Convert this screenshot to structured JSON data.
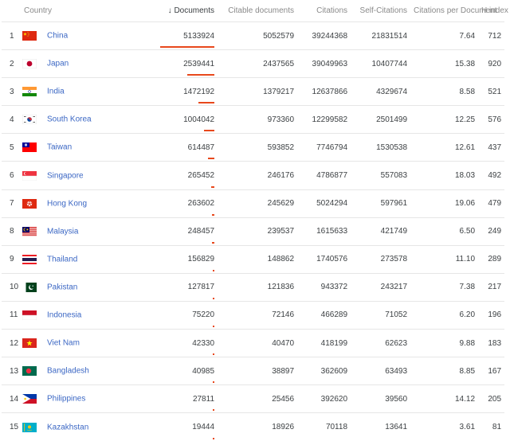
{
  "header": {
    "country": "Country",
    "sort_arrow": "↓",
    "documents": "Documents",
    "citable_documents": "Citable documents",
    "citations": "Citations",
    "self_citations": "Self-Citations",
    "citations_per_document": "Citations per Document",
    "h_index": "H index"
  },
  "colors": {
    "link": "#3b67c4",
    "bar": "#e8481c"
  },
  "rows": [
    {
      "rank": "1",
      "flag": "china-flag",
      "country": "China",
      "documents": "5133924",
      "citable": "5052579",
      "citations": "39244368",
      "self": "21831514",
      "cpd": "7.64",
      "h": "712",
      "bar": 1.0
    },
    {
      "rank": "2",
      "flag": "japan-flag",
      "country": "Japan",
      "documents": "2539441",
      "citable": "2437565",
      "citations": "39049963",
      "self": "10407744",
      "cpd": "15.38",
      "h": "920",
      "bar": 0.495
    },
    {
      "rank": "3",
      "flag": "india-flag",
      "country": "India",
      "documents": "1472192",
      "citable": "1379217",
      "citations": "12637866",
      "self": "4329674",
      "cpd": "8.58",
      "h": "521",
      "bar": 0.287
    },
    {
      "rank": "4",
      "flag": "south-korea-flag",
      "country": "South Korea",
      "documents": "1004042",
      "citable": "973360",
      "citations": "12299582",
      "self": "2501499",
      "cpd": "12.25",
      "h": "576",
      "bar": 0.196
    },
    {
      "rank": "5",
      "flag": "taiwan-flag",
      "country": "Taiwan",
      "documents": "614487",
      "citable": "593852",
      "citations": "7746794",
      "self": "1530538",
      "cpd": "12.61",
      "h": "437",
      "bar": 0.12
    },
    {
      "rank": "6",
      "flag": "singapore-flag",
      "country": "Singapore",
      "documents": "265452",
      "citable": "246176",
      "citations": "4786877",
      "self": "557083",
      "cpd": "18.03",
      "h": "492",
      "bar": 0.052
    },
    {
      "rank": "7",
      "flag": "hong-kong-flag",
      "country": "Hong Kong",
      "documents": "263602",
      "citable": "245629",
      "citations": "5024294",
      "self": "597961",
      "cpd": "19.06",
      "h": "479",
      "bar": 0.051
    },
    {
      "rank": "8",
      "flag": "malaysia-flag",
      "country": "Malaysia",
      "documents": "248457",
      "citable": "239537",
      "citations": "1615633",
      "self": "421749",
      "cpd": "6.50",
      "h": "249",
      "bar": 0.048
    },
    {
      "rank": "9",
      "flag": "thailand-flag",
      "country": "Thailand",
      "documents": "156829",
      "citable": "148862",
      "citations": "1740576",
      "self": "273578",
      "cpd": "11.10",
      "h": "289",
      "bar": 0.031
    },
    {
      "rank": "10",
      "flag": "pakistan-flag",
      "country": "Pakistan",
      "documents": "127817",
      "citable": "121836",
      "citations": "943372",
      "self": "243217",
      "cpd": "7.38",
      "h": "217",
      "bar": 0.025
    },
    {
      "rank": "11",
      "flag": "indonesia-flag",
      "country": "Indonesia",
      "documents": "75220",
      "citable": "72146",
      "citations": "466289",
      "self": "71052",
      "cpd": "6.20",
      "h": "196",
      "bar": 0.015
    },
    {
      "rank": "12",
      "flag": "viet-nam-flag",
      "country": "Viet Nam",
      "documents": "42330",
      "citable": "40470",
      "citations": "418199",
      "self": "62623",
      "cpd": "9.88",
      "h": "183",
      "bar": 0.008
    },
    {
      "rank": "13",
      "flag": "bangladesh-flag",
      "country": "Bangladesh",
      "documents": "40985",
      "citable": "38897",
      "citations": "362609",
      "self": "63493",
      "cpd": "8.85",
      "h": "167",
      "bar": 0.008
    },
    {
      "rank": "14",
      "flag": "philippines-flag",
      "country": "Philippines",
      "documents": "27811",
      "citable": "25456",
      "citations": "392620",
      "self": "39560",
      "cpd": "14.12",
      "h": "205",
      "bar": 0.005
    },
    {
      "rank": "15",
      "flag": "kazakhstan-flag",
      "country": "Kazakhstan",
      "documents": "19444",
      "citable": "18926",
      "citations": "70118",
      "self": "13641",
      "cpd": "3.61",
      "h": "81",
      "bar": 0.004
    }
  ]
}
